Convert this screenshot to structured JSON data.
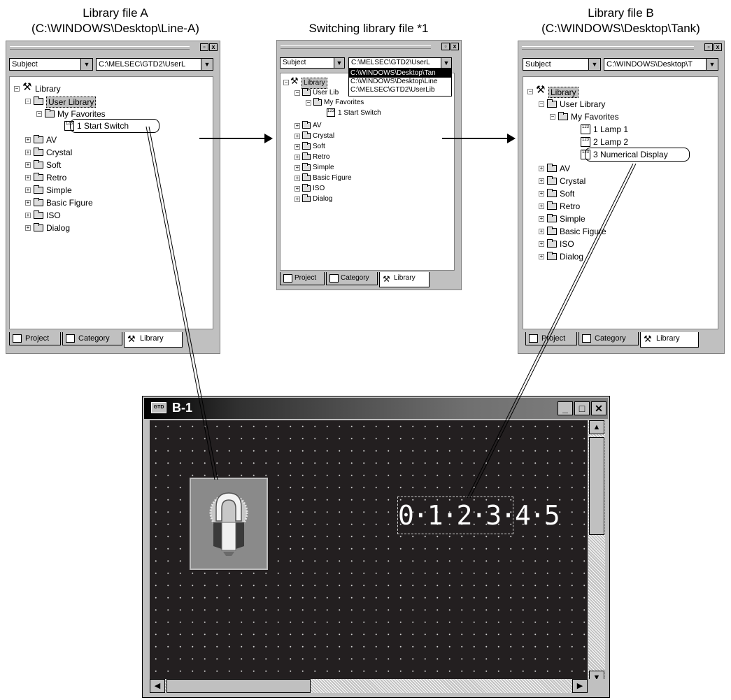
{
  "captions": {
    "file_a_title": "Library file A",
    "file_a_path": "(C:\\WINDOWS\\Desktop\\Line-A)",
    "switching": "Switching library file *1",
    "file_b_title": "Library file B",
    "file_b_path": "(C:\\WINDOWS\\Desktop\\Tank)"
  },
  "panel_a": {
    "combo_left": "Subject",
    "combo_right": "C:\\MELSEC\\GTD2\\UserL",
    "tree": {
      "root": "Library",
      "user_library": "User Library",
      "favorites": "My Favorites",
      "item1": "1 Start Switch",
      "folders": [
        "AV",
        "Crystal",
        "Soft",
        "Retro",
        "Simple",
        "Basic Figure",
        "ISO",
        "Dialog"
      ]
    },
    "tabs": [
      "Project",
      "Category",
      "Library"
    ]
  },
  "panel_mid": {
    "combo_left": "Subject",
    "combo_right": "C:\\MELSEC\\GTD2\\UserL",
    "dropdown_options": [
      "C:\\WINDOWS\\Desktop\\Tan",
      "C:\\WINDOWS\\Desktop\\Line",
      "C:\\MELSEC\\GTD2\\UserLib"
    ],
    "tree": {
      "root": "Library",
      "user_library": "User Lib",
      "favorites": "My Favorites",
      "item1": "1 Start Switch",
      "folders": [
        "AV",
        "Crystal",
        "Soft",
        "Retro",
        "Simple",
        "Basic Figure",
        "ISO",
        "Dialog"
      ]
    },
    "tabs": [
      "Project",
      "Category",
      "Library"
    ]
  },
  "panel_b": {
    "combo_left": "Subject",
    "combo_right": "C:\\WINDOWS\\Desktop\\T",
    "tree": {
      "root": "Library",
      "user_library": "User Library",
      "favorites": "My Favorites",
      "items": [
        "1 Lamp 1",
        "2 Lamp 2",
        "3 Numerical Display"
      ],
      "folders": [
        "AV",
        "Crystal",
        "Soft",
        "Retro",
        "Simple",
        "Basic Figure",
        "ISO",
        "Dialog"
      ]
    },
    "tabs": [
      "Project",
      "Category",
      "Library"
    ]
  },
  "screen_window": {
    "title": "B-1",
    "icon": "GTD",
    "numeric_display": "0·1·2·3·4·5"
  }
}
